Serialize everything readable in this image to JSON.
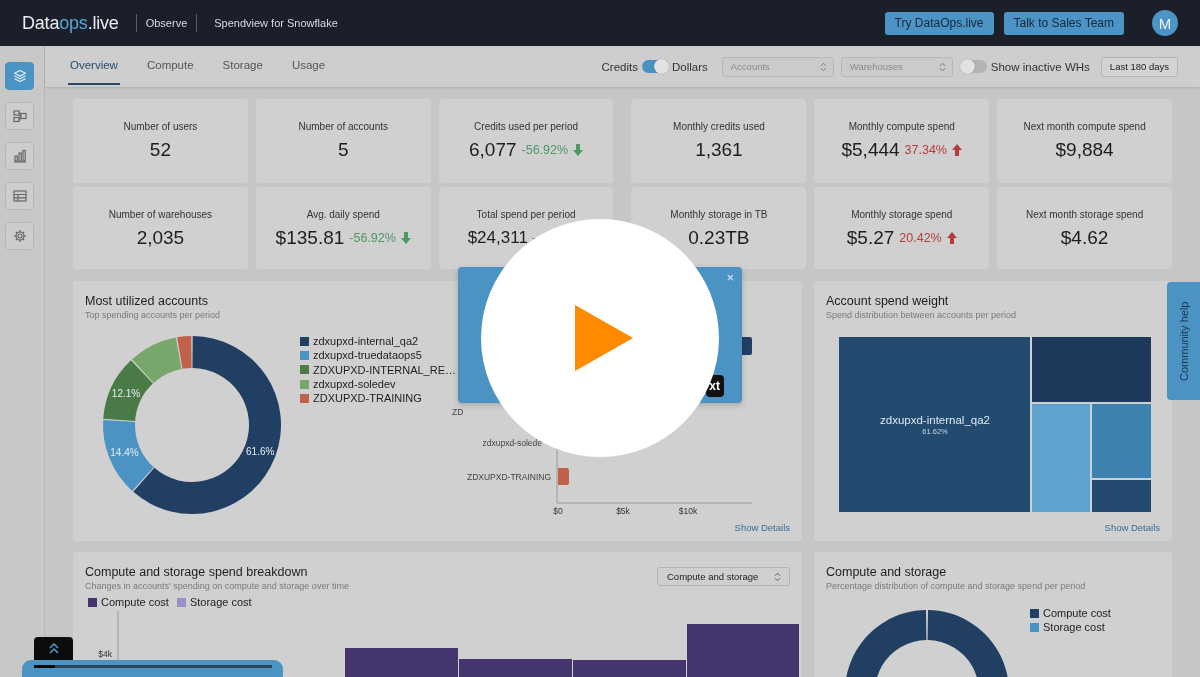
{
  "header": {
    "logo": {
      "lead": "Data",
      "accent": "ops",
      "tail": ".live"
    },
    "breadcrumbs": [
      "Observe",
      "Spendview for Snowflake"
    ],
    "buttons": [
      "Try DataOps.live",
      "Talk to Sales Team"
    ],
    "avatar": "M"
  },
  "sidebar": {
    "items": [
      {
        "kind": "layers",
        "selected": true
      },
      {
        "kind": "layout",
        "selected": false
      },
      {
        "kind": "chart",
        "selected": false
      },
      {
        "kind": "table",
        "selected": false
      },
      {
        "kind": "settings",
        "selected": false
      }
    ]
  },
  "tabs": [
    {
      "label": "Overview",
      "selected": true
    },
    {
      "label": "Compute",
      "selected": false
    },
    {
      "label": "Storage",
      "selected": false
    },
    {
      "label": "Usage",
      "selected": false
    }
  ],
  "filters": {
    "unit_toggle": {
      "left_label": "Credits",
      "right_label": "Dollars",
      "on": true
    },
    "selects": [
      {
        "placeholder": "Accounts"
      },
      {
        "placeholder": "Warehouses"
      }
    ],
    "inactive_toggle": {
      "label": "Show inactive WHs",
      "on": false
    },
    "period_button": "Last 180 days"
  },
  "kpis": [
    {
      "label": "Number of users",
      "value": "52"
    },
    {
      "label": "Number of accounts",
      "value": "5"
    },
    {
      "label": "Credits used per period",
      "value": "6,077",
      "delta": "-56.92%",
      "rising": false,
      "arrow": true
    },
    {
      "label": "Monthly credits used",
      "value": "1,361"
    },
    {
      "label": "Monthly compute spend",
      "value": "$5,444",
      "delta": "37.34%",
      "rising": true,
      "arrow": true
    },
    {
      "label": "Next month compute spend",
      "value": "$9,884"
    },
    {
      "label": "Number of warehouses",
      "value": "2,035"
    },
    {
      "label": "Avg. daily spend",
      "value": "$135.81",
      "delta": "-56.92%",
      "rising": false,
      "arrow": true
    },
    {
      "label": "Total spend per period",
      "value": "$24,311",
      "delta": "-",
      "rising": false,
      "arrow": false
    },
    {
      "label": "Monthly storage in TB",
      "value": "0.23TB"
    },
    {
      "label": "Monthly storage spend",
      "value": "$5.27",
      "delta": "20.42%",
      "rising": true,
      "arrow": true
    },
    {
      "label": "Next month storage spend",
      "value": "$4.62"
    }
  ],
  "most_utilized_accounts": {
    "title": "Most utilized accounts",
    "subtitle": "Top spending accounts per period",
    "chart_data": {
      "type": "donut",
      "categories": [
        "zdxupxd-internal_qa2",
        "zdxupxd-truedataops5",
        "ZDXUPXD-INTERNAL_RE…",
        "zdxupxd-soledev",
        "ZDXUPXD-TRAINING"
      ],
      "values": [
        61.6,
        14.4,
        12.1,
        9.1,
        2.8
      ],
      "colors": [
        "#213f62",
        "#4b93c3",
        "#4a7a46",
        "#77a76a",
        "#c0624a"
      ],
      "value_labels": [
        "61.6%",
        "14.4%",
        "12.1%",
        null,
        null
      ]
    },
    "bar_chart": {
      "labels": [
        "ZD",
        "zdxupxd-solede",
        "ZDXUPXD-TRAINING"
      ],
      "ticks": [
        "$0",
        "$5k",
        "$10k"
      ]
    },
    "link": "Show Details"
  },
  "account_spend_weight": {
    "title": "Account spend weight",
    "subtitle": "Spend distribution between accounts per period",
    "main_tile": {
      "label": "zdxupxd-internal_qa2",
      "share": "61.62%"
    },
    "link": "Show Details"
  },
  "spend_breakdown": {
    "title": "Compute and storage spend breakdown",
    "subtitle": "Changes in accounts' spending on compute and storage over time",
    "select": {
      "value": "Compute and storage"
    },
    "legend": [
      {
        "name": "Compute cost",
        "color": "#46366f"
      },
      {
        "name": "Storage cost",
        "color": "#9990c8"
      }
    ],
    "y_tick": "$4k"
  },
  "compute_and_storage": {
    "title": "Compute and storage",
    "subtitle": "Percentage distribution of compute and storage spend per period",
    "legend": [
      {
        "name": "Compute cost",
        "color": "#213f62"
      },
      {
        "name": "Storage cost",
        "color": "#4b93c3"
      }
    ]
  },
  "community_help": "Community help",
  "tour_popover": {
    "close": "×",
    "next_button": "xt"
  },
  "video_player": {
    "progress": {
      "level": 0.09
    }
  }
}
